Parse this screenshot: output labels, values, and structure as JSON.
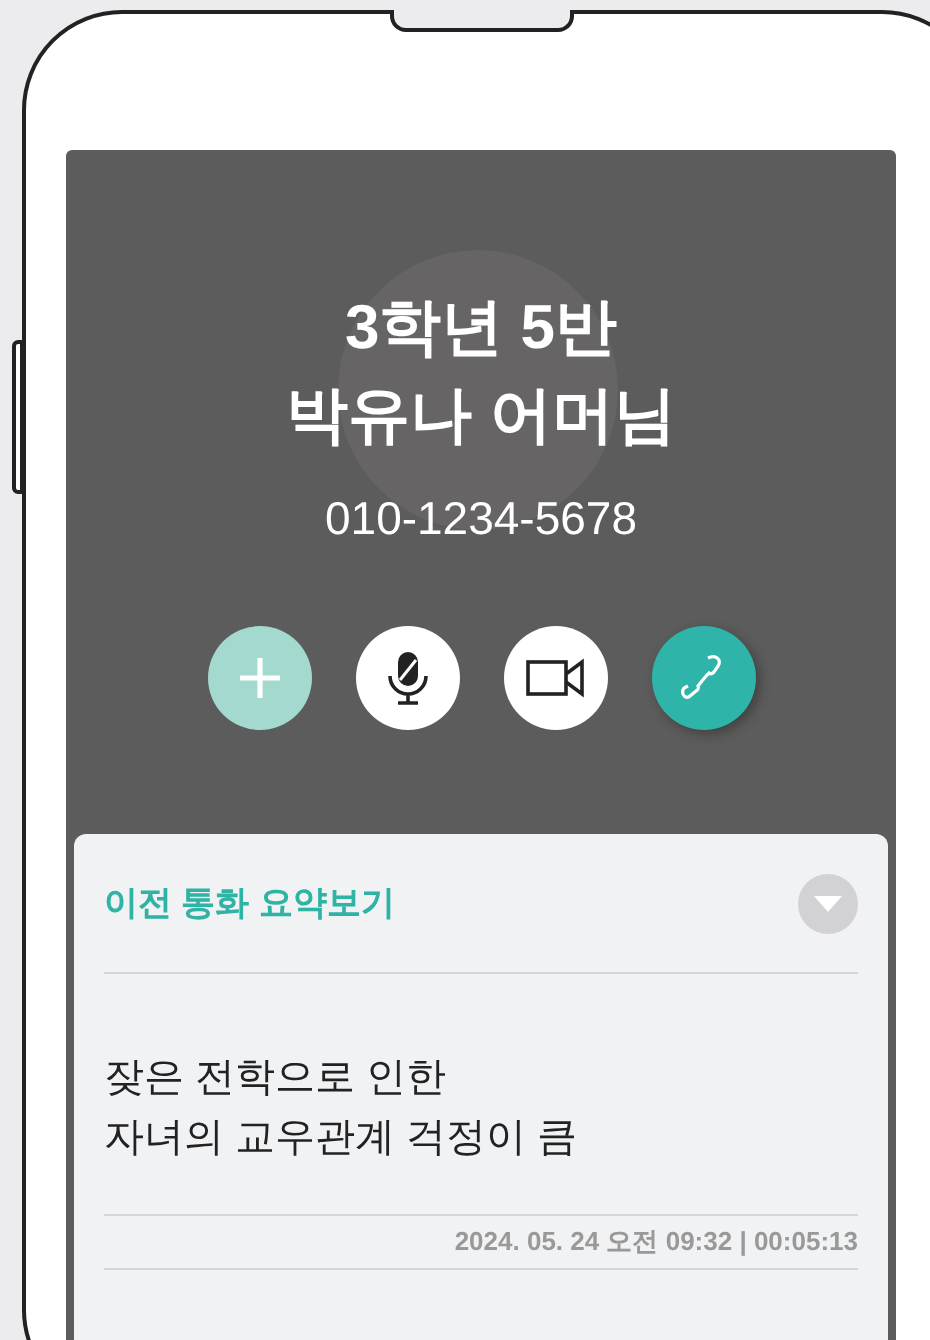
{
  "caller": {
    "name_lines": [
      "3학년 5반",
      "박유나 어머님"
    ],
    "phone": "010-1234-5678"
  },
  "actions": [
    {
      "kind": "add"
    },
    {
      "kind": "mute"
    },
    {
      "kind": "video"
    },
    {
      "kind": "call"
    }
  ],
  "summary": {
    "title": "이전 통화 요약보기",
    "lines": [
      "잦은 전학으로 인한",
      "자녀의 교우관계 걱정이 큼"
    ],
    "timestamp": "2024. 05. 24 오전 09:32 | 00:05:13"
  }
}
